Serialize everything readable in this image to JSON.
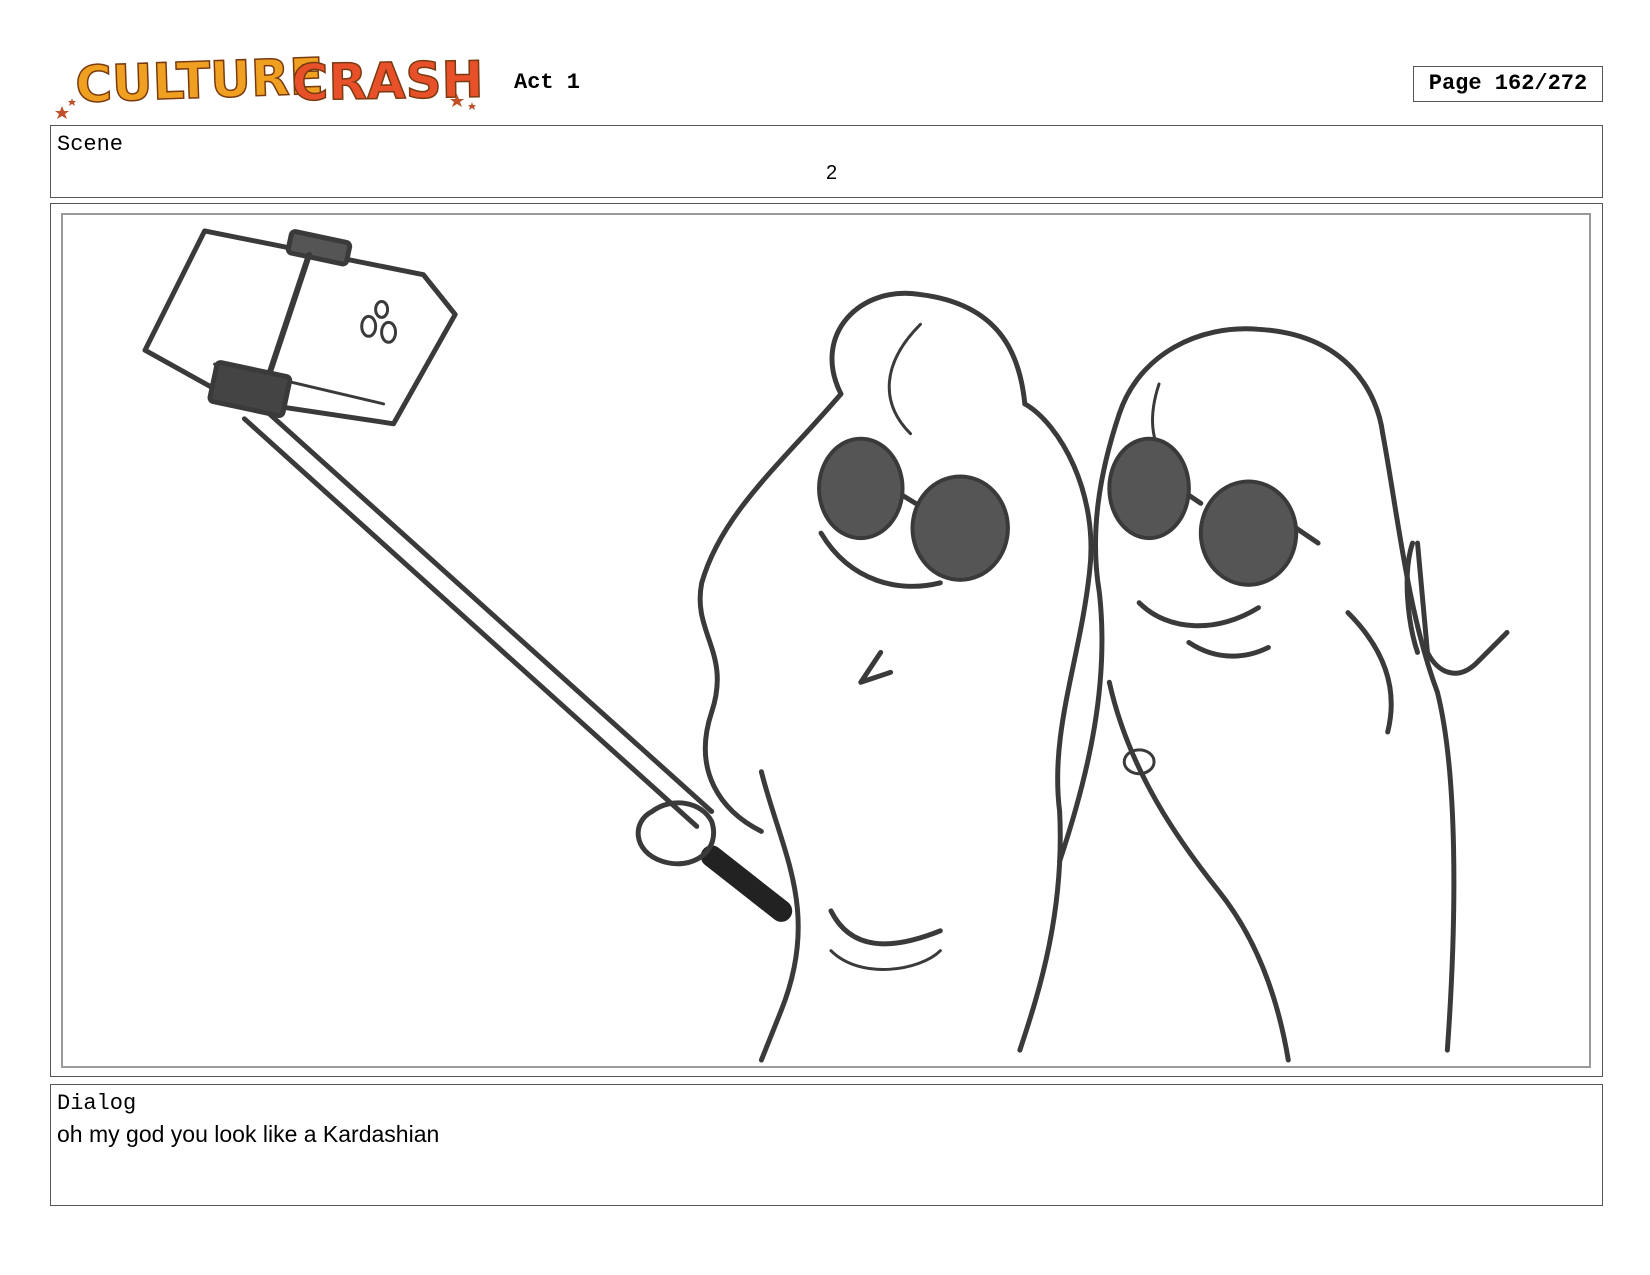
{
  "header": {
    "logo_text": "CULTURE CRASH",
    "act": "Act 1",
    "page": "Page 162/272"
  },
  "scene": {
    "label": "Scene",
    "number": "2"
  },
  "dialog": {
    "label": "Dialog",
    "text": "oh my god you look like a Kardashian"
  },
  "colors": {
    "logo_culture": "#f0a020",
    "logo_crash": "#e8502a",
    "sketch_line": "#3a3a3a",
    "frame_border": "#555555"
  },
  "panel_image": "storyboard sketch"
}
